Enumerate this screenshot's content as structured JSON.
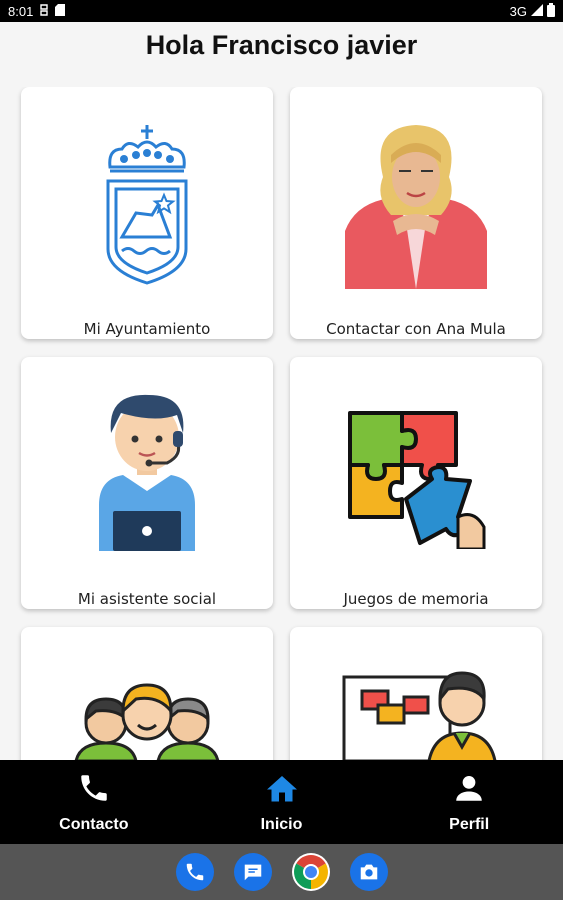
{
  "status_bar": {
    "time": "8:01",
    "network": "3G"
  },
  "greeting": "Hola Francisco javier",
  "cards": [
    {
      "label": "Mi Ayuntamiento",
      "icon": "coat-of-arms-icon"
    },
    {
      "label": "Contactar con Ana Mula",
      "icon": "person-photo"
    },
    {
      "label": "Mi asistente social",
      "icon": "support-agent-icon"
    },
    {
      "label": "Juegos de memoria",
      "icon": "puzzle-icon"
    },
    {
      "label": "",
      "icon": "group-icon"
    },
    {
      "label": "",
      "icon": "presentation-icon"
    }
  ],
  "bottom_nav": {
    "items": [
      {
        "label": "Contacto",
        "icon": "phone-icon",
        "color": "#ffffff"
      },
      {
        "label": "Inicio",
        "icon": "home-icon",
        "color": "#1e88e5"
      },
      {
        "label": "Perfil",
        "icon": "person-icon",
        "color": "#ffffff"
      }
    ]
  },
  "dock": [
    "phone-app-icon",
    "messages-app-icon",
    "chrome-app-icon",
    "camera-app-icon"
  ],
  "colors": {
    "accent": "#1e88e5",
    "nav_bg": "#000000",
    "system_nav_bg": "#555555"
  }
}
